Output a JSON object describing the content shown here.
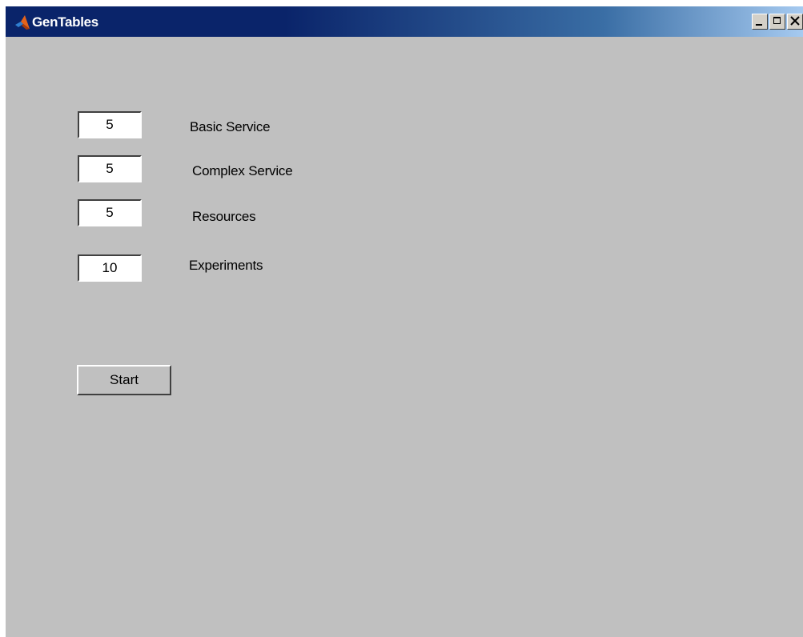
{
  "window": {
    "title": "GenTables",
    "icon": "matlab-icon",
    "controls": {
      "minimize_icon": "minimize-icon",
      "maximize_icon": "maximize-icon",
      "close_icon": "close-icon"
    },
    "titlebar_color": "#0a246a",
    "client_color": "#c0c0c0"
  },
  "form": {
    "fields": [
      {
        "value": "5",
        "label": "Basic Service"
      },
      {
        "value": "5",
        "label": "Complex Service"
      },
      {
        "value": "5",
        "label": "Resources"
      },
      {
        "value": "10",
        "label": "Experiments"
      }
    ],
    "start_label": "Start"
  }
}
